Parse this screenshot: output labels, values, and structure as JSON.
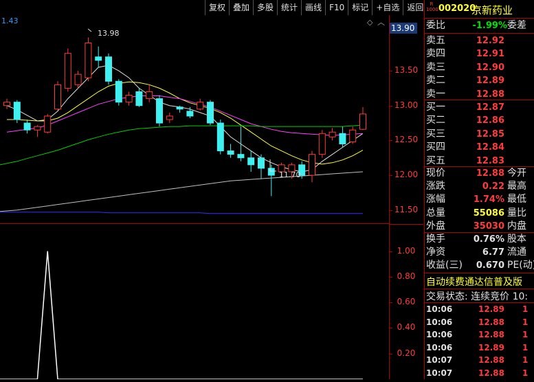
{
  "toolbar": {
    "buttons": [
      "复权",
      "叠加",
      "多股",
      "统计",
      "画线",
      "F10",
      "标记",
      "+自选",
      "返回"
    ]
  },
  "top_left_value": "1.43",
  "stock": {
    "badge_top": "R",
    "badge_bottom": "1000",
    "code": "002020",
    "name": "京新药业"
  },
  "commission": {
    "ratio_label": "委比",
    "ratio_value": "-1.99%",
    "diff_label": "委差"
  },
  "asks": [
    {
      "label": "卖五",
      "price": "12.92"
    },
    {
      "label": "卖四",
      "price": "12.91"
    },
    {
      "label": "卖三",
      "price": "12.90"
    },
    {
      "label": "卖二",
      "price": "12.89"
    },
    {
      "label": "卖一",
      "price": "12.88"
    }
  ],
  "bids": [
    {
      "label": "买一",
      "price": "12.87"
    },
    {
      "label": "买二",
      "price": "12.86"
    },
    {
      "label": "买三",
      "price": "12.85"
    },
    {
      "label": "买四",
      "price": "12.84"
    },
    {
      "label": "买五",
      "price": "12.83"
    }
  ],
  "quote": [
    {
      "label": "现价",
      "value": "12.88",
      "color": "#ff3b3b",
      "label2": "今开"
    },
    {
      "label": "涨跌",
      "value": "0.22",
      "color": "#ff3b3b",
      "label2": "最高"
    },
    {
      "label": "涨幅",
      "value": "1.74%",
      "color": "#ff3b3b",
      "label2": "最低"
    },
    {
      "label": "总量",
      "value": "55086",
      "color": "#ffff33",
      "label2": "量比"
    },
    {
      "label": "外盘",
      "value": "35030",
      "color": "#ff3b3b",
      "label2": "内盘"
    }
  ],
  "fundamentals": [
    {
      "label": "换手",
      "value": "0.76%",
      "label2": "股本"
    },
    {
      "label": "净资",
      "value": "6.77",
      "label2": "流通"
    },
    {
      "label": "收益(三)",
      "value": "0.670",
      "label2": "PE(动)"
    }
  ],
  "notice": "自动续费通达信普及版",
  "trade_status": "交易状态: 连续竞价 10:",
  "ticks": [
    {
      "time": "10:06",
      "price": "12.89",
      "vol": "1"
    },
    {
      "time": "10:06",
      "price": "12.88",
      "vol": "1"
    },
    {
      "time": "10:06",
      "price": "12.88",
      "vol": "1"
    },
    {
      "time": "10:06",
      "price": "12.89",
      "vol": "1"
    },
    {
      "time": "10:07",
      "price": "12.88",
      "vol": "1"
    },
    {
      "time": "10:07",
      "price": "12.88",
      "vol": "1"
    }
  ],
  "yaxis_main": {
    "current": "13.90",
    "labels": [
      "13.50",
      "13.00",
      "12.50",
      "12.00",
      "11.50"
    ]
  },
  "yaxis_sub": {
    "labels": [
      "1.00",
      "0.80",
      "0.60",
      "0.40",
      "0.20"
    ]
  },
  "annotations": {
    "high": "13.98",
    "low": "11.70"
  },
  "colors": {
    "up": "#ff3b3b",
    "down": "#40f0f0",
    "ma5": "#e0e0e0",
    "ma10": "#ffff33",
    "ma20": "#ff40ff",
    "ma60": "#00d000",
    "ma120": "#c0c0c0",
    "ma250": "#3030ff",
    "border": "#b00000"
  },
  "chart_data": {
    "type": "candlestick",
    "ylim": [
      11.3,
      14.3
    ],
    "candles": [
      {
        "o": 13.0,
        "c": 13.05,
        "h": 13.1,
        "l": 12.95
      },
      {
        "o": 13.05,
        "c": 12.8,
        "h": 13.08,
        "l": 12.75
      },
      {
        "o": 12.75,
        "c": 12.65,
        "h": 12.8,
        "l": 12.6
      },
      {
        "o": 12.65,
        "c": 12.7,
        "h": 12.72,
        "l": 12.55
      },
      {
        "o": 12.62,
        "c": 12.85,
        "h": 12.88,
        "l": 12.6
      },
      {
        "o": 12.95,
        "c": 13.3,
        "h": 13.35,
        "l": 12.93
      },
      {
        "o": 13.25,
        "c": 13.75,
        "h": 13.82,
        "l": 13.2
      },
      {
        "o": 13.3,
        "c": 13.45,
        "h": 13.5,
        "l": 13.25
      },
      {
        "o": 13.4,
        "c": 13.9,
        "h": 13.98,
        "l": 13.35
      },
      {
        "o": 13.7,
        "c": 13.65,
        "h": 13.85,
        "l": 13.55
      },
      {
        "o": 13.7,
        "c": 13.35,
        "h": 13.75,
        "l": 13.3
      },
      {
        "o": 13.35,
        "c": 13.05,
        "h": 13.38,
        "l": 13.0
      },
      {
        "o": 13.05,
        "c": 13.15,
        "h": 13.2,
        "l": 13.0
      },
      {
        "o": 13.2,
        "c": 13.0,
        "h": 13.25,
        "l": 12.98
      },
      {
        "o": 13.1,
        "c": 13.2,
        "h": 13.3,
        "l": 13.05
      },
      {
        "o": 13.1,
        "c": 12.75,
        "h": 13.15,
        "l": 12.7
      },
      {
        "o": 12.8,
        "c": 12.85,
        "h": 12.9,
        "l": 12.75
      },
      {
        "o": 12.98,
        "c": 12.95,
        "h": 13.0,
        "l": 12.9
      },
      {
        "o": 12.92,
        "c": 12.85,
        "h": 12.98,
        "l": 12.82
      },
      {
        "o": 12.95,
        "c": 13.05,
        "h": 13.1,
        "l": 12.93
      },
      {
        "o": 13.05,
        "c": 12.75,
        "h": 13.08,
        "l": 12.72
      },
      {
        "o": 12.75,
        "c": 12.35,
        "h": 12.8,
        "l": 12.3
      },
      {
        "o": 12.35,
        "c": 12.3,
        "h": 12.45,
        "l": 12.25
      },
      {
        "o": 12.3,
        "c": 12.25,
        "h": 12.7,
        "l": 12.2
      },
      {
        "o": 12.25,
        "c": 12.15,
        "h": 12.35,
        "l": 12.05
      },
      {
        "o": 12.25,
        "c": 12.1,
        "h": 12.3,
        "l": 11.95
      },
      {
        "o": 12.1,
        "c": 12.0,
        "h": 12.15,
        "l": 11.7
      },
      {
        "o": 12.05,
        "c": 12.15,
        "h": 12.18,
        "l": 11.98
      },
      {
        "o": 12.05,
        "c": 12.15,
        "h": 12.18,
        "l": 11.95
      },
      {
        "o": 12.15,
        "c": 12.0,
        "h": 12.2,
        "l": 11.95
      },
      {
        "o": 12.0,
        "c": 12.3,
        "h": 12.35,
        "l": 11.9
      },
      {
        "o": 12.3,
        "c": 12.6,
        "h": 12.65,
        "l": 12.25
      },
      {
        "o": 12.55,
        "c": 12.62,
        "h": 12.68,
        "l": 12.5
      },
      {
        "o": 12.6,
        "c": 12.45,
        "h": 12.7,
        "l": 12.4
      },
      {
        "o": 12.48,
        "c": 12.65,
        "h": 12.7,
        "l": 12.45
      },
      {
        "o": 12.66,
        "c": 12.88,
        "h": 12.98,
        "l": 12.65
      }
    ],
    "ma_series": [
      {
        "key": "ma5",
        "values": [
          13.0,
          12.94,
          12.86,
          12.78,
          12.8,
          12.92,
          13.1,
          13.25,
          13.4,
          13.55,
          13.58,
          13.5,
          13.4,
          13.25,
          13.15,
          13.05,
          13.0,
          12.98,
          12.95,
          12.9,
          12.85,
          12.7,
          12.55,
          12.45,
          12.35,
          12.25,
          12.18,
          12.12,
          12.08,
          12.05,
          12.08,
          12.2,
          12.3,
          12.4,
          12.5,
          12.6
        ]
      },
      {
        "key": "ma10",
        "values": [
          12.8,
          12.8,
          12.79,
          12.78,
          12.78,
          12.82,
          12.9,
          13.0,
          13.1,
          13.2,
          13.28,
          13.32,
          13.34,
          13.33,
          13.3,
          13.25,
          13.18,
          13.1,
          13.04,
          13.0,
          12.96,
          12.9,
          12.82,
          12.72,
          12.62,
          12.52,
          12.42,
          12.35,
          12.28,
          12.22,
          12.18,
          12.16,
          12.18,
          12.22,
          12.28,
          12.36
        ]
      },
      {
        "key": "ma20",
        "values": [
          12.62,
          12.64,
          12.66,
          12.68,
          12.72,
          12.78,
          12.84,
          12.9,
          12.96,
          13.02,
          13.06,
          13.1,
          13.12,
          13.14,
          13.14,
          13.14,
          13.12,
          13.1,
          13.06,
          13.02,
          12.98,
          12.92,
          12.86,
          12.8,
          12.74,
          12.7,
          12.66,
          12.63,
          12.61,
          12.6,
          12.59,
          12.58,
          12.57,
          12.58,
          12.59,
          12.6
        ]
      },
      {
        "key": "ma60",
        "values": [
          12.15,
          12.2,
          12.24,
          12.28,
          12.32,
          12.36,
          12.41,
          12.46,
          12.51,
          12.55,
          12.59,
          12.62,
          12.65,
          12.67,
          12.68,
          12.69,
          12.7,
          12.7,
          12.71,
          12.71,
          12.71,
          12.71,
          12.71,
          12.71,
          12.71,
          12.7,
          12.7,
          12.7,
          12.7,
          12.7,
          12.7,
          12.7,
          12.7,
          12.7,
          12.71,
          12.72
        ]
      },
      {
        "key": "ma120",
        "values": [
          11.48,
          11.5,
          11.52,
          11.54,
          11.56,
          11.58,
          11.6,
          11.62,
          11.64,
          11.66,
          11.68,
          11.7,
          11.72,
          11.74,
          11.76,
          11.78,
          11.8,
          11.82,
          11.84,
          11.86,
          11.88,
          11.9,
          11.92,
          11.93,
          11.94,
          11.95,
          11.96,
          11.97,
          11.98,
          11.99,
          12.0,
          12.01,
          12.02,
          12.03,
          12.04,
          12.05
        ]
      },
      {
        "key": "ma250",
        "values": [
          11.47,
          11.47,
          11.47,
          11.47,
          11.47,
          11.47,
          11.47,
          11.47,
          11.47,
          11.47,
          11.46,
          11.46,
          11.46,
          11.46,
          11.46,
          11.46,
          11.46,
          11.46,
          11.46,
          11.46,
          11.45,
          11.45,
          11.45,
          11.45,
          11.45,
          11.45,
          11.45,
          11.45,
          11.45,
          11.45,
          11.45,
          11.45,
          11.45,
          11.45,
          11.45,
          11.45
        ]
      }
    ],
    "indicator": {
      "ylim": [
        0,
        1.1
      ],
      "values": [
        0,
        0,
        0,
        0,
        1,
        0,
        0,
        0,
        0,
        0,
        0,
        0,
        0,
        0,
        0,
        0,
        0,
        0,
        0,
        0,
        0,
        0,
        0,
        0,
        0,
        0,
        0,
        0,
        0,
        0,
        0,
        0,
        0,
        0,
        0,
        0
      ]
    }
  }
}
